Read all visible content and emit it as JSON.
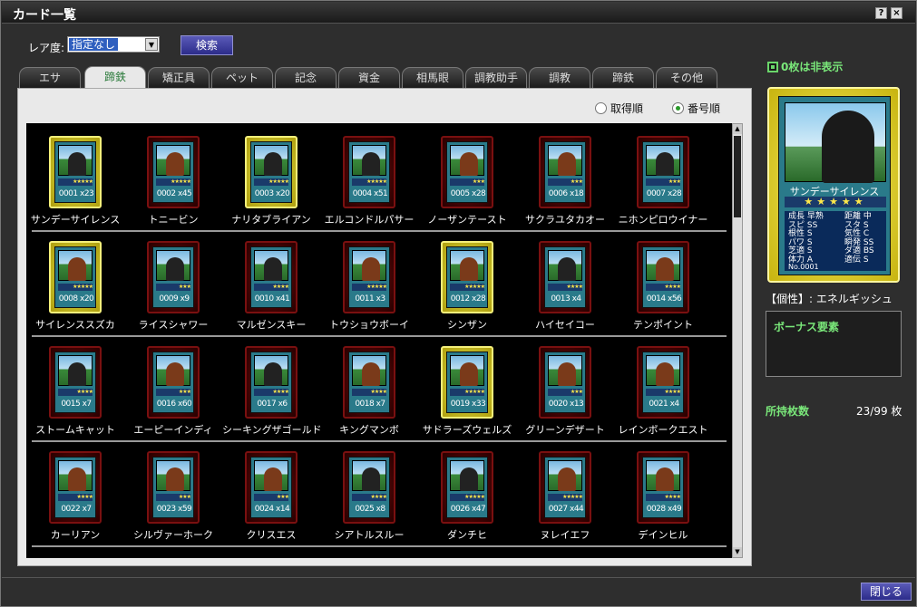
{
  "window": {
    "title": "カード一覧"
  },
  "filter": {
    "rarity_label": "レア度:",
    "rarity_value": "指定なし",
    "search_label": "検索"
  },
  "tabs": [
    {
      "label": "エサ"
    },
    {
      "label": "蹄鉄"
    },
    {
      "label": "矯正具"
    },
    {
      "label": "ペット"
    },
    {
      "label": "記念"
    },
    {
      "label": "資金"
    },
    {
      "label": "相馬眼"
    },
    {
      "label": "調教助手"
    },
    {
      "label": "調教"
    },
    {
      "label": "蹄鉄"
    },
    {
      "label": "その他"
    }
  ],
  "active_tab": 1,
  "sort": {
    "acquired_label": "取得順",
    "number_label": "番号順",
    "selected": "番号順"
  },
  "cards": [
    {
      "name": "サンデーサイレンス",
      "no": "0001",
      "count": "x23",
      "gold": true,
      "stars": "★★★★★",
      "color": "black"
    },
    {
      "name": "トニービン",
      "no": "0002",
      "count": "x45",
      "gold": false,
      "stars": "★★★★★",
      "color": "bay"
    },
    {
      "name": "ナリタブライアン",
      "no": "0003",
      "count": "x20",
      "gold": true,
      "stars": "★★★★★",
      "color": "black"
    },
    {
      "name": "エルコンドルパサー",
      "no": "0004",
      "count": "x51",
      "gold": false,
      "stars": "★★★★★",
      "color": "black"
    },
    {
      "name": "ノーザンテースト",
      "no": "0005",
      "count": "x28",
      "gold": false,
      "stars": "★★★",
      "color": "bay"
    },
    {
      "name": "サクラユタカオー",
      "no": "0006",
      "count": "x18",
      "gold": false,
      "stars": "★★★",
      "color": "bay"
    },
    {
      "name": "ニホンピロウイナー",
      "no": "0007",
      "count": "x28",
      "gold": false,
      "stars": "★★★",
      "color": "black"
    },
    {
      "name": "サイレンススズカ",
      "no": "0008",
      "count": "x20",
      "gold": true,
      "stars": "★★★★★",
      "color": "bay"
    },
    {
      "name": "ライスシャワー",
      "no": "0009",
      "count": "x9",
      "gold": false,
      "stars": "★★★",
      "color": "black"
    },
    {
      "name": "マルゼンスキー",
      "no": "0010",
      "count": "x41",
      "gold": false,
      "stars": "★★★★",
      "color": "black"
    },
    {
      "name": "トウショウボーイ",
      "no": "0011",
      "count": "x3",
      "gold": false,
      "stars": "★★★★★",
      "color": "bay"
    },
    {
      "name": "シンザン",
      "no": "0012",
      "count": "x28",
      "gold": true,
      "stars": "★★★★★",
      "color": "bay"
    },
    {
      "name": "ハイセイコー",
      "no": "0013",
      "count": "x4",
      "gold": false,
      "stars": "★★★★",
      "color": "black"
    },
    {
      "name": "テンポイント",
      "no": "0014",
      "count": "x56",
      "gold": false,
      "stars": "★★★★",
      "color": "bay"
    },
    {
      "name": "ストームキャット",
      "no": "0015",
      "count": "x7",
      "gold": false,
      "stars": "★★★★",
      "color": "black"
    },
    {
      "name": "エーピーインディ",
      "no": "0016",
      "count": "x60",
      "gold": false,
      "stars": "★★★",
      "color": "bay"
    },
    {
      "name": "シーキングザゴールド",
      "no": "0017",
      "count": "x6",
      "gold": false,
      "stars": "★★★★",
      "color": "black"
    },
    {
      "name": "キングマンボ",
      "no": "0018",
      "count": "x7",
      "gold": false,
      "stars": "★★★★",
      "color": "bay"
    },
    {
      "name": "サドラーズウェルズ",
      "no": "0019",
      "count": "x33",
      "gold": true,
      "stars": "★★★★★",
      "color": "bay"
    },
    {
      "name": "グリーンデザート",
      "no": "0020",
      "count": "x13",
      "gold": false,
      "stars": "★★★",
      "color": "bay"
    },
    {
      "name": "レインボークエスト",
      "no": "0021",
      "count": "x4",
      "gold": false,
      "stars": "★★★★",
      "color": "bay"
    },
    {
      "name": "カーリアン",
      "no": "0022",
      "count": "x7",
      "gold": false,
      "stars": "★★★★",
      "color": "bay"
    },
    {
      "name": "シルヴァーホーク",
      "no": "0023",
      "count": "x59",
      "gold": false,
      "stars": "★★★",
      "color": "bay"
    },
    {
      "name": "クリスエス",
      "no": "0024",
      "count": "x14",
      "gold": false,
      "stars": "★★★",
      "color": "bay"
    },
    {
      "name": "シアトルスルー",
      "no": "0025",
      "count": "x8",
      "gold": false,
      "stars": "★★★★",
      "color": "black"
    },
    {
      "name": "ダンチヒ",
      "no": "0026",
      "count": "x47",
      "gold": false,
      "stars": "★★★★★",
      "color": "black"
    },
    {
      "name": "ヌレイエフ",
      "no": "0027",
      "count": "x44",
      "gold": false,
      "stars": "★★★★★",
      "color": "bay"
    },
    {
      "name": "デインヒル",
      "no": "0028",
      "count": "x49",
      "gold": false,
      "stars": "★★★★",
      "color": "bay"
    }
  ],
  "side": {
    "hide_zero_label": "0枚は非表示",
    "detail": {
      "name": "サンデーサイレンス",
      "stars": "★★★★★",
      "left_stats": [
        "成長 早熟",
        "スピ SS",
        "根性 S",
        "パワ S",
        "芝適 S",
        "体力 A"
      ],
      "right_stats": [
        "距離 中",
        "スタ S",
        "気性 C",
        "瞬発 SS",
        "ダ適 BS",
        "適伝 S"
      ],
      "no": "No.0001"
    },
    "kosei": "【個性】: エネルギッシュ",
    "bonus_title": "ボーナス要素",
    "owned_label": "所持枚数",
    "owned_value": "23/99 枚"
  },
  "footer": {
    "close_label": "閉じる"
  }
}
